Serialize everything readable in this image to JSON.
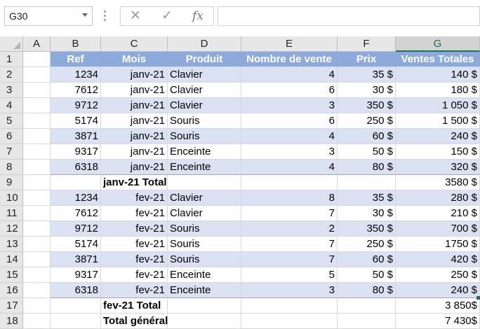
{
  "formula_bar": {
    "name_box": "G30",
    "cancel_icon": "✕",
    "enter_icon": "✓",
    "function_label": "fx",
    "formula": ""
  },
  "columns": [
    "A",
    "B",
    "C",
    "D",
    "E",
    "F",
    "G"
  ],
  "selected_column": "G",
  "rows": [
    [
      "",
      "Ref",
      "Mois",
      "Produit",
      "Nombre de vente",
      "Prix",
      "Ventes Totales"
    ],
    [
      "",
      "1234",
      "janv-21",
      "Clavier",
      "4",
      "35 $",
      "140 $"
    ],
    [
      "",
      "7612",
      "janv-21",
      "Clavier",
      "6",
      "30 $",
      "180 $"
    ],
    [
      "",
      "9712",
      "janv-21",
      "Clavier",
      "3",
      "350 $",
      "1 050 $"
    ],
    [
      "",
      "5174",
      "janv-21",
      "Souris",
      "6",
      "250 $",
      "1 500 $"
    ],
    [
      "",
      "3871",
      "janv-21",
      "Souris",
      "4",
      "60 $",
      "240 $"
    ],
    [
      "",
      "9317",
      "janv-21",
      "Enceinte",
      "3",
      "50 $",
      "150 $"
    ],
    [
      "",
      "6318",
      "janv-21",
      "Enceinte",
      "4",
      "80 $",
      "320 $"
    ],
    [
      "",
      "",
      "janv-21 Total",
      "",
      "",
      "",
      "3580 $"
    ],
    [
      "",
      "1234",
      "fev-21",
      "Clavier",
      "8",
      "35 $",
      "280 $"
    ],
    [
      "",
      "7612",
      "fev-21",
      "Clavier",
      "7",
      "30 $",
      "210 $"
    ],
    [
      "",
      "9712",
      "fev-21",
      "Souris",
      "2",
      "350 $",
      "700 $"
    ],
    [
      "",
      "5174",
      "fev-21",
      "Souris",
      "7",
      "250 $",
      "1750 $"
    ],
    [
      "",
      "3871",
      "fev-21",
      "Souris",
      "7",
      "60 $",
      "420 $"
    ],
    [
      "",
      "9317",
      "fev-21",
      "Enceinte",
      "5",
      "50 $",
      "250 $"
    ],
    [
      "",
      "6318",
      "fev-21",
      "Enceinte",
      "3",
      "80 $",
      "240 $"
    ],
    [
      "",
      "",
      "fev-21 Total",
      "",
      "",
      "",
      "3 850$"
    ],
    [
      "",
      "",
      "Total général",
      "",
      "",
      "",
      "7 430$"
    ]
  ],
  "colors": {
    "header_fill": "#8eaadb",
    "band_fill": "#d9e1f2",
    "accent": "#217346"
  }
}
